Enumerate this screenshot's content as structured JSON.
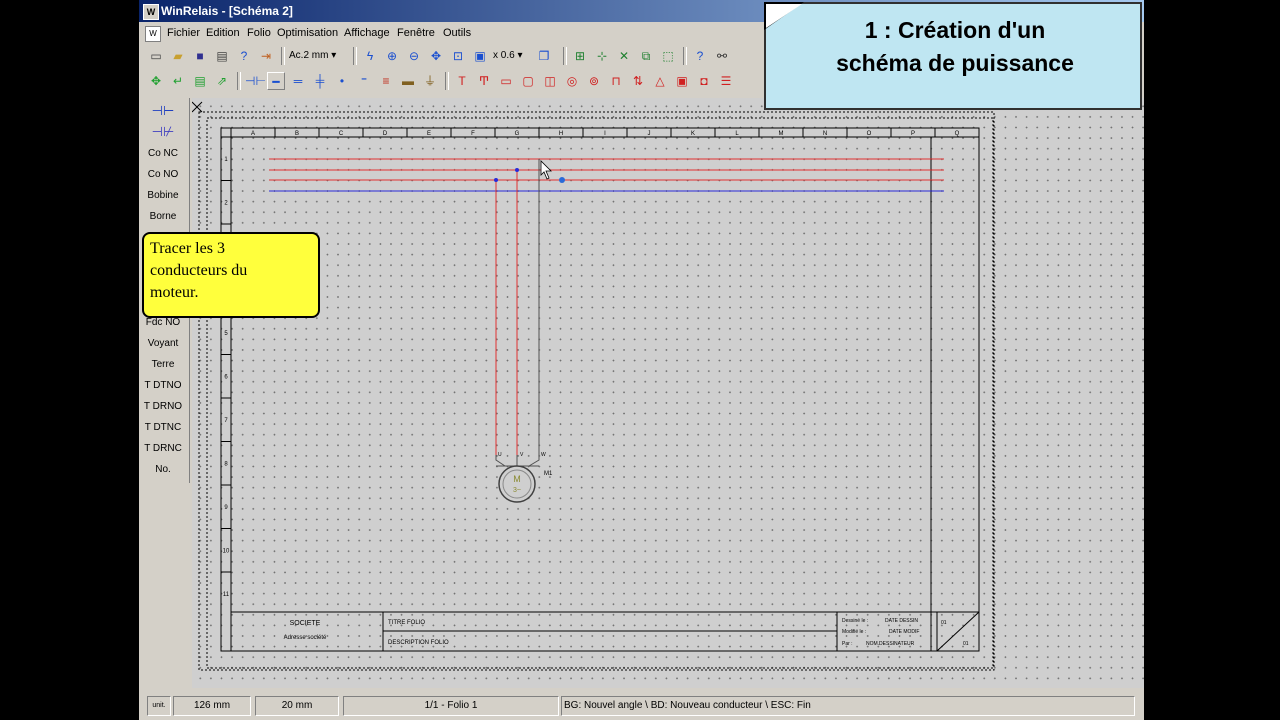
{
  "window": {
    "title": "WinRelais - [Schéma 2]"
  },
  "menu": [
    "Fichier",
    "Edition",
    "Folio",
    "Optimisation",
    "Affichage",
    "Fenêtre",
    "Outils"
  ],
  "toolbar": {
    "line_width": "Ac.2 mm",
    "zoom": "x 0.6"
  },
  "palette": [
    "Co NC",
    "Co NO",
    "Bobine",
    "Borne",
    "Fdc NO",
    "Voyant",
    "Terre",
    "T DTNO",
    "T DRNO",
    "T DTNC",
    "T DRNC",
    "No."
  ],
  "sheet": {
    "columns": [
      "A",
      "B",
      "C",
      "D",
      "E",
      "F",
      "G",
      "H",
      "I",
      "J",
      "K",
      "L",
      "M",
      "N",
      "O",
      "P",
      "Q"
    ],
    "rows": [
      "1",
      "2",
      "3",
      "4",
      "5",
      "6",
      "7",
      "8",
      "9",
      "10",
      "11"
    ],
    "motor": {
      "label": "M",
      "phase": "3~",
      "ref": "M1",
      "terminals": [
        "U",
        "V",
        "W"
      ]
    },
    "cartouche": {
      "company": "SOCIETE",
      "address": "Adresse société",
      "title": "TITRE FOLIO",
      "description": "DESCRIPTION FOLIO",
      "drawn_label": "Dessiné le :",
      "drawn_value": "DATE DESSIN",
      "modified_label": "Modifié le :",
      "modified_value": "DATE MODIF",
      "by_label": "Par :",
      "by_value": "NOM.DESSINATEUR",
      "folio_top": "01",
      "folio_bottom": "01"
    }
  },
  "status": {
    "unit": "unit.",
    "x": "126 mm",
    "y": "20 mm",
    "folio": "1/1 - Folio 1",
    "hint": "BG: Nouvel angle \\ BD: Nouveau conducteur \\ ESC: Fin"
  },
  "callout": {
    "line1": "1 : Création d'un",
    "line2": "schéma de puissance"
  },
  "tip": {
    "line1": "Tracer les 3",
    "line2": "conducteurs du",
    "line3": "moteur."
  },
  "colors": {
    "phase": "#e23030",
    "neutral": "#2a2ad8",
    "wire_active": "#505050",
    "callout_bg": "#bfe6f2",
    "tip_bg": "#ffff3c"
  }
}
